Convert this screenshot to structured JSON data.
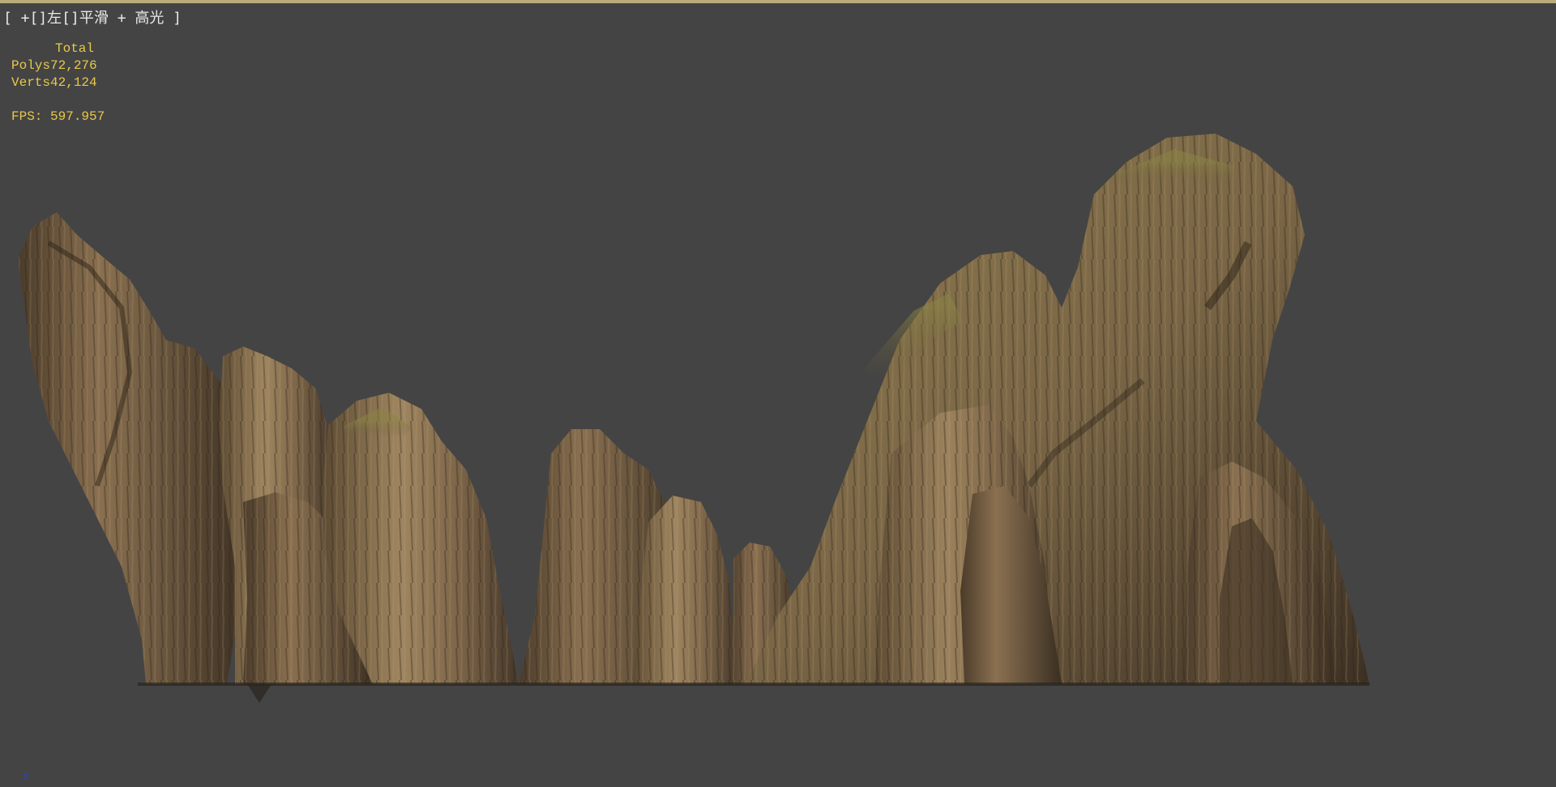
{
  "viewport": {
    "label": "[ +[]左[]平滑 + 高光 ]",
    "axis_indicator": "z"
  },
  "stats": {
    "total_label": "Total",
    "polys_label": "Polys",
    "polys_value": "72,276",
    "verts_label": "Verts",
    "verts_value": "42,124",
    "fps_label": "FPS:",
    "fps_value": "597.957"
  },
  "colors": {
    "background": "#444444",
    "stats_text": "#e8c84a",
    "label_text": "#e8e8e8",
    "axis_text": "#2a3fd8",
    "rock_base": "#7a6447",
    "rock_light": "#a88d64",
    "rock_dark": "#3b2f22",
    "moss": "#7d7a3a"
  },
  "scene": {
    "description_icon": "rock-formation-model"
  }
}
